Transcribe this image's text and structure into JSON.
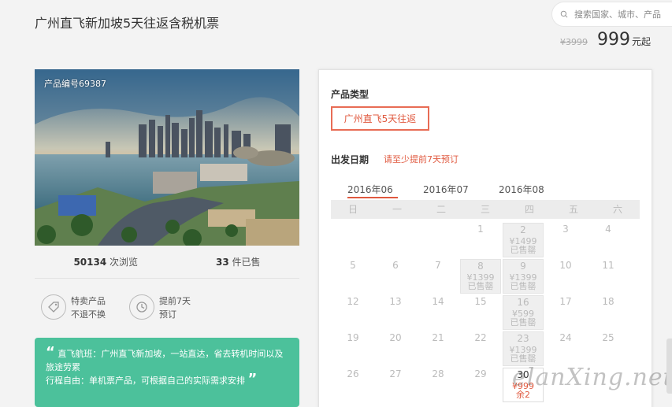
{
  "page": {
    "title": "广州直飞新加坡5天往返含税机票"
  },
  "search": {
    "placeholder": "搜索国家、城市、产品"
  },
  "price": {
    "original": "¥3999",
    "current": "999",
    "unit": "元起"
  },
  "product": {
    "code": "产品编号69387",
    "views_count": "50134",
    "views_label": "次浏览",
    "sold_count": "33",
    "sold_label": "件已售"
  },
  "features": [
    {
      "line1": "特卖产品",
      "line2": "不退不换",
      "icon": "tag-icon"
    },
    {
      "line1": "提前7天",
      "line2": "预订",
      "icon": "clock-icon"
    }
  ],
  "highlights": {
    "text1": "直飞航班：广州直飞新加坡，一站直达，省去转机时间以及旅途劳累",
    "text2": "行程自由：单机票产品，可根据自己的实际需求安排"
  },
  "booking": {
    "type_label": "产品类型",
    "type_option": "广州直飞5天往返",
    "date_label": "出发日期",
    "date_tip": "请至少提前7天预订",
    "months": [
      "2016年06",
      "2016年07",
      "2016年08"
    ],
    "weekdays": [
      "日",
      "一",
      "二",
      "三",
      "四",
      "五",
      "六"
    ],
    "days": [
      {
        "d": "1",
        "c": 3,
        "r": 0
      },
      {
        "d": "2",
        "c": 4,
        "r": 0,
        "p": "¥1499",
        "s": "已售罄",
        "st": "grey"
      },
      {
        "d": "3",
        "c": 5,
        "r": 0
      },
      {
        "d": "4",
        "c": 6,
        "r": 0
      },
      {
        "d": "5",
        "c": 0,
        "r": 1
      },
      {
        "d": "6",
        "c": 1,
        "r": 1
      },
      {
        "d": "7",
        "c": 2,
        "r": 1
      },
      {
        "d": "8",
        "c": 3,
        "r": 1,
        "p": "¥1399",
        "s": "已售罄",
        "st": "grey"
      },
      {
        "d": "9",
        "c": 4,
        "r": 1,
        "p": "¥1399",
        "s": "已售罄",
        "st": "grey"
      },
      {
        "d": "10",
        "c": 5,
        "r": 1
      },
      {
        "d": "11",
        "c": 6,
        "r": 1
      },
      {
        "d": "12",
        "c": 0,
        "r": 2
      },
      {
        "d": "13",
        "c": 1,
        "r": 2
      },
      {
        "d": "14",
        "c": 2,
        "r": 2
      },
      {
        "d": "15",
        "c": 3,
        "r": 2
      },
      {
        "d": "16",
        "c": 4,
        "r": 2,
        "p": "¥599",
        "s": "已售罄",
        "st": "grey"
      },
      {
        "d": "17",
        "c": 5,
        "r": 2
      },
      {
        "d": "18",
        "c": 6,
        "r": 2
      },
      {
        "d": "19",
        "c": 0,
        "r": 3
      },
      {
        "d": "20",
        "c": 1,
        "r": 3
      },
      {
        "d": "21",
        "c": 2,
        "r": 3
      },
      {
        "d": "22",
        "c": 3,
        "r": 3
      },
      {
        "d": "23",
        "c": 4,
        "r": 3,
        "p": "¥1399",
        "s": "已售罄",
        "st": "grey"
      },
      {
        "d": "24",
        "c": 5,
        "r": 3
      },
      {
        "d": "25",
        "c": 6,
        "r": 3
      },
      {
        "d": "26",
        "c": 0,
        "r": 4
      },
      {
        "d": "27",
        "c": 1,
        "r": 4
      },
      {
        "d": "28",
        "c": 2,
        "r": 4
      },
      {
        "d": "29",
        "c": 3,
        "r": 4
      },
      {
        "d": "30",
        "c": 4,
        "r": 4,
        "p": "¥999",
        "s": "余2",
        "st": "avail"
      }
    ]
  },
  "watermark": "elanXing.net",
  "colors": {
    "accent": "#e0593f",
    "green": "#4cc19b"
  }
}
